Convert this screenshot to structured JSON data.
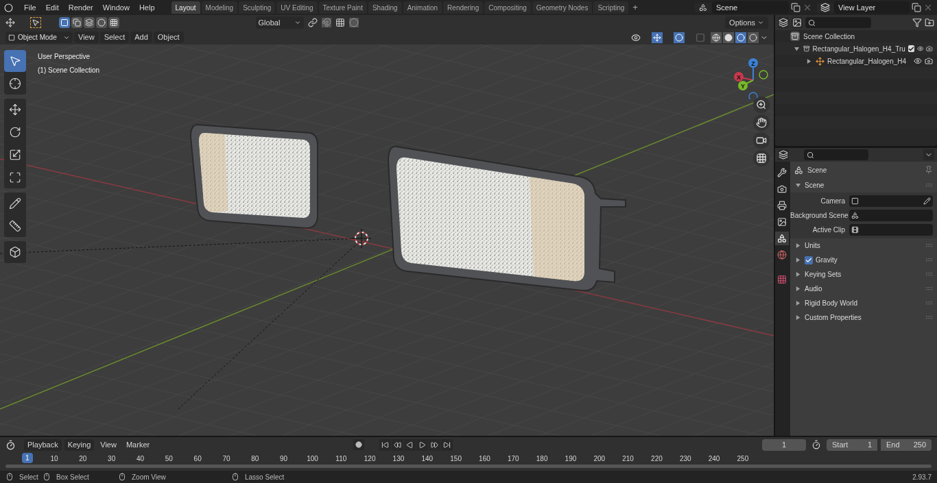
{
  "menu": [
    "File",
    "Edit",
    "Render",
    "Window",
    "Help"
  ],
  "workspaces": [
    {
      "label": "Layout",
      "selected": true
    },
    {
      "label": "Modeling",
      "selected": false
    },
    {
      "label": "Sculpting",
      "selected": false
    },
    {
      "label": "UV Editing",
      "selected": false
    },
    {
      "label": "Texture Paint",
      "selected": false
    },
    {
      "label": "Shading",
      "selected": false
    },
    {
      "label": "Animation",
      "selected": false
    },
    {
      "label": "Rendering",
      "selected": false
    },
    {
      "label": "Compositing",
      "selected": false
    },
    {
      "label": "Geometry Nodes",
      "selected": false
    },
    {
      "label": "Scripting",
      "selected": false
    }
  ],
  "add_workspace": "+",
  "scene_selector": {
    "value": "Scene"
  },
  "view_layer_selector": {
    "value": "View Layer"
  },
  "tool_header": {
    "select_modes": [
      {
        "kind": "new",
        "selected": true
      },
      {
        "kind": "extend",
        "selected": false
      },
      {
        "kind": "subtract",
        "selected": false
      },
      {
        "kind": "invert",
        "selected": false
      },
      {
        "kind": "intersect",
        "selected": false
      }
    ],
    "orientation": "Global",
    "options": "Options"
  },
  "viewport_header": {
    "mode": "Object Mode",
    "menus": [
      "View",
      "Select",
      "Add",
      "Object"
    ],
    "gizmos_on": true,
    "overlays_on": true,
    "shading": [
      {
        "kind": "wireframe",
        "selected": false
      },
      {
        "kind": "solid",
        "selected": false
      },
      {
        "kind": "material",
        "selected": true
      },
      {
        "kind": "rendered",
        "selected": false
      }
    ]
  },
  "viewport_overlay": [
    "User Perspective",
    "(1) Scene Collection"
  ],
  "toolbar": [
    [
      {
        "kind": "select",
        "selected": true
      },
      {
        "kind": "cursor",
        "selected": false
      }
    ],
    [
      {
        "kind": "move",
        "selected": false
      },
      {
        "kind": "rotate",
        "selected": false
      },
      {
        "kind": "scale",
        "selected": false
      },
      {
        "kind": "transform",
        "selected": false
      }
    ],
    [
      {
        "kind": "annotate",
        "selected": false
      },
      {
        "kind": "measure",
        "selected": false
      }
    ],
    [
      {
        "kind": "add-cube",
        "selected": false
      }
    ]
  ],
  "gizmo_axes": [
    "X",
    "Y",
    "Z"
  ],
  "outliner": {
    "root": "Scene Collection",
    "items": [
      {
        "label": "Rectangular_Halogen_H4_Tru",
        "kind": "collection",
        "expanded": true,
        "checked": true,
        "children": [
          {
            "label": "Rectangular_Halogen_H4",
            "kind": "empty",
            "expanded": false
          }
        ]
      }
    ]
  },
  "properties": {
    "tabs": [
      {
        "kind": "tool",
        "selected": false
      },
      {
        "kind": "render",
        "selected": false
      },
      {
        "kind": "output",
        "selected": false
      },
      {
        "kind": "view-layer",
        "selected": false
      },
      {
        "kind": "scene",
        "selected": true
      },
      {
        "kind": "world",
        "selected": false
      },
      {
        "kind": "texture",
        "selected": false
      }
    ],
    "context": "Scene",
    "sections": [
      {
        "title": "Scene",
        "expanded": true,
        "fields": [
          {
            "label": "Camera",
            "kind": "camera"
          },
          {
            "label": "Background Scene",
            "kind": "scene"
          },
          {
            "label": "Active Clip",
            "kind": "clip"
          }
        ]
      },
      {
        "title": "Units",
        "expanded": false
      },
      {
        "title": "Gravity",
        "expanded": false,
        "checked": true
      },
      {
        "title": "Keying Sets",
        "expanded": false
      },
      {
        "title": "Audio",
        "expanded": false
      },
      {
        "title": "Rigid Body World",
        "expanded": false
      },
      {
        "title": "Custom Properties",
        "expanded": false
      }
    ]
  },
  "timeline": {
    "menus": [
      "Playback",
      "Keying",
      "View",
      "Marker"
    ],
    "current_frame": "1",
    "start_label": "Start",
    "start": "1",
    "end_label": "End",
    "end": "250",
    "playhead": "1",
    "ruler": [
      "10",
      "20",
      "30",
      "40",
      "50",
      "60",
      "70",
      "80",
      "90",
      "100",
      "110",
      "120",
      "130",
      "140",
      "150",
      "160",
      "170",
      "180",
      "190",
      "200",
      "210",
      "220",
      "230",
      "240",
      "250"
    ]
  },
  "status_bar": {
    "hints": [
      "Select",
      "Box Select",
      "Zoom View",
      "Lasso Select"
    ],
    "version": "2.93.7"
  }
}
